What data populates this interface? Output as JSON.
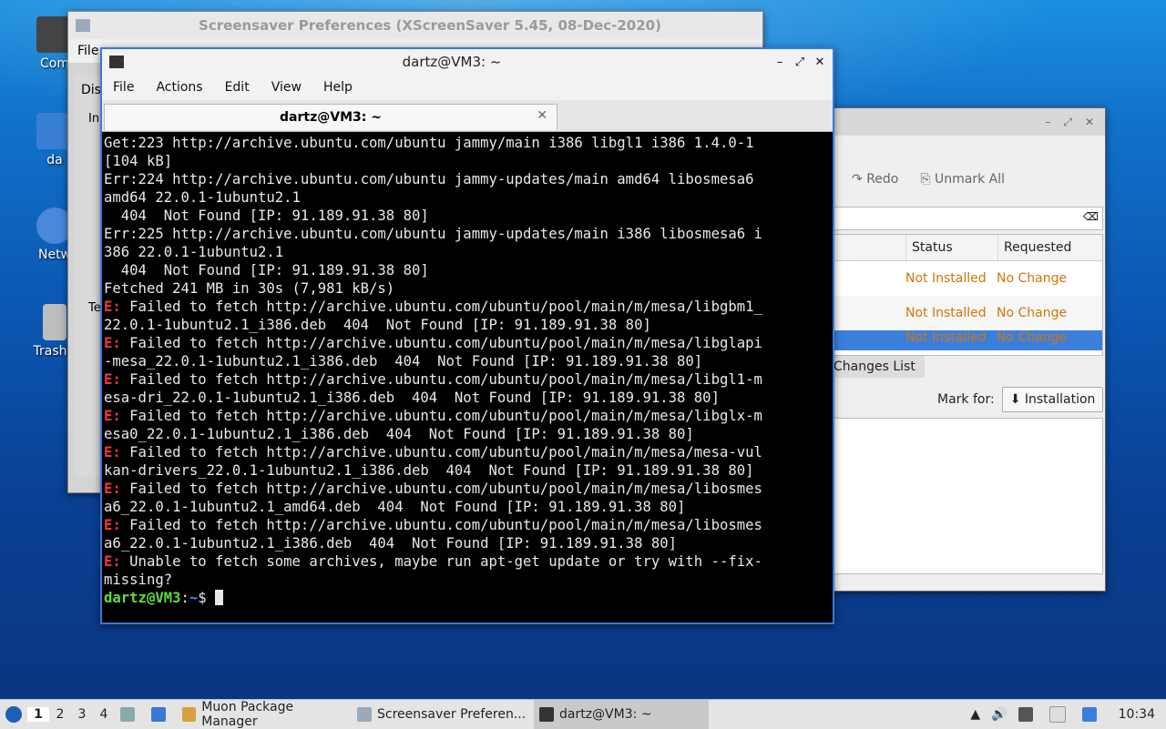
{
  "desktop": {
    "icons": [
      {
        "label": "Com"
      },
      {
        "label": "da"
      },
      {
        "label": "Netw"
      },
      {
        "label": "Trash ("
      }
    ]
  },
  "screensaver": {
    "title": "Screensaver Preferences  (XScreenSaver 5.45, 08-Dec-2020)",
    "menu_file": "File",
    "tab_partial": "Dis",
    "frag1": "In",
    "frag2": "Te"
  },
  "muon": {
    "redo": "Redo",
    "unmark_all": "Unmark All",
    "col_status": "Status",
    "col_requested": "Requested",
    "rows": [
      {
        "status": "Not Installed",
        "requested": "No Change"
      },
      {
        "status": "Not Installed",
        "requested": "No Change"
      },
      {
        "status": "Not Installed",
        "requested": "No Change"
      }
    ],
    "changes_tab": "Changes List",
    "mark_for_label": "Mark for:",
    "mark_for_value": "Installation"
  },
  "terminal": {
    "title": "dartz@VM3: ~",
    "menu": [
      "File",
      "Actions",
      "Edit",
      "View",
      "Help"
    ],
    "tab_label": "dartz@VM3: ~",
    "lines": [
      {
        "err": "",
        "text": "Get:223 http://archive.ubuntu.com/ubuntu jammy/main i386 libgl1 i386 1.4.0-1"
      },
      {
        "err": "",
        "text": "[104 kB]"
      },
      {
        "err": "",
        "text": "Err:224 http://archive.ubuntu.com/ubuntu jammy-updates/main amd64 libosmesa6"
      },
      {
        "err": "",
        "text": "amd64 22.0.1-1ubuntu2.1"
      },
      {
        "err": "",
        "text": "  404  Not Found [IP: 91.189.91.38 80]"
      },
      {
        "err": "",
        "text": "Err:225 http://archive.ubuntu.com/ubuntu jammy-updates/main i386 libosmesa6 i"
      },
      {
        "err": "",
        "text": "386 22.0.1-1ubuntu2.1"
      },
      {
        "err": "",
        "text": "  404  Not Found [IP: 91.189.91.38 80]"
      },
      {
        "err": "",
        "text": "Fetched 241 MB in 30s (7,981 kB/s)"
      },
      {
        "err": "E:",
        "text": " Failed to fetch http://archive.ubuntu.com/ubuntu/pool/main/m/mesa/libgbm1_"
      },
      {
        "err": "",
        "text": "22.0.1-1ubuntu2.1_i386.deb  404  Not Found [IP: 91.189.91.38 80]"
      },
      {
        "err": "E:",
        "text": " Failed to fetch http://archive.ubuntu.com/ubuntu/pool/main/m/mesa/libglapi"
      },
      {
        "err": "",
        "text": "-mesa_22.0.1-1ubuntu2.1_i386.deb  404  Not Found [IP: 91.189.91.38 80]"
      },
      {
        "err": "E:",
        "text": " Failed to fetch http://archive.ubuntu.com/ubuntu/pool/main/m/mesa/libgl1-m"
      },
      {
        "err": "",
        "text": "esa-dri_22.0.1-1ubuntu2.1_i386.deb  404  Not Found [IP: 91.189.91.38 80]"
      },
      {
        "err": "E:",
        "text": " Failed to fetch http://archive.ubuntu.com/ubuntu/pool/main/m/mesa/libglx-m"
      },
      {
        "err": "",
        "text": "esa0_22.0.1-1ubuntu2.1_i386.deb  404  Not Found [IP: 91.189.91.38 80]"
      },
      {
        "err": "E:",
        "text": " Failed to fetch http://archive.ubuntu.com/ubuntu/pool/main/m/mesa/mesa-vul"
      },
      {
        "err": "",
        "text": "kan-drivers_22.0.1-1ubuntu2.1_i386.deb  404  Not Found [IP: 91.189.91.38 80]"
      },
      {
        "err": "E:",
        "text": " Failed to fetch http://archive.ubuntu.com/ubuntu/pool/main/m/mesa/libosmes"
      },
      {
        "err": "",
        "text": "a6_22.0.1-1ubuntu2.1_amd64.deb  404  Not Found [IP: 91.189.91.38 80]"
      },
      {
        "err": "E:",
        "text": " Failed to fetch http://archive.ubuntu.com/ubuntu/pool/main/m/mesa/libosmes"
      },
      {
        "err": "",
        "text": "a6_22.0.1-1ubuntu2.1_i386.deb  404  Not Found [IP: 91.189.91.38 80]"
      },
      {
        "err": "E:",
        "text": " Unable to fetch some archives, maybe run apt-get update or try with --fix-"
      },
      {
        "err": "",
        "text": "missing?"
      }
    ],
    "prompt_user": "dartz@VM3",
    "prompt_sep": ":",
    "prompt_dir": "~",
    "prompt_sym": "$ "
  },
  "taskbar": {
    "workspaces": [
      "1",
      "2",
      "3",
      "4"
    ],
    "tasks": [
      {
        "label": "Muon Package Manager"
      },
      {
        "label": "Screensaver Preferen..."
      },
      {
        "label": "dartz@VM3: ~"
      }
    ],
    "clock": "10:34"
  },
  "colors": {
    "error": "#f03838",
    "prompt_user": "#5fdc3c",
    "prompt_dir": "#5a8cf2",
    "muon_status": "#d4740a",
    "selection": "#3b7fdd"
  }
}
